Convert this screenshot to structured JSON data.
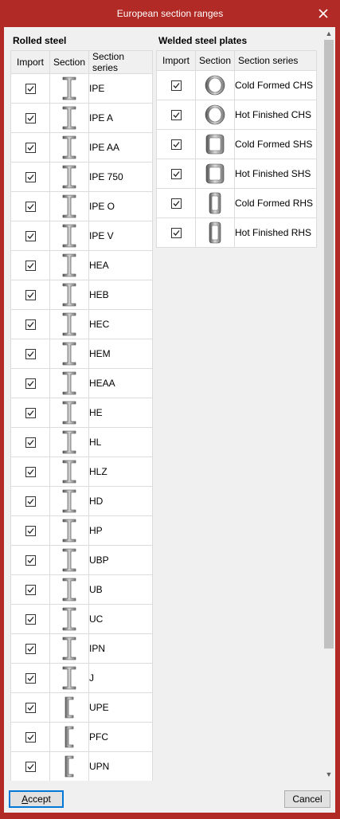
{
  "window": {
    "title": "European section ranges",
    "close_icon": "close-icon"
  },
  "columns": {
    "import": "Import",
    "section": "Section",
    "series": "Section series"
  },
  "rolled": {
    "title": "Rolled steel",
    "rows": [
      {
        "checked": true,
        "shape": "i-beam",
        "name": "IPE"
      },
      {
        "checked": true,
        "shape": "i-beam",
        "name": "IPE A"
      },
      {
        "checked": true,
        "shape": "i-beam",
        "name": "IPE AA"
      },
      {
        "checked": true,
        "shape": "i-beam",
        "name": "IPE 750"
      },
      {
        "checked": true,
        "shape": "i-beam",
        "name": "IPE O"
      },
      {
        "checked": true,
        "shape": "i-beam",
        "name": "IPE V"
      },
      {
        "checked": true,
        "shape": "i-beam",
        "name": "HEA"
      },
      {
        "checked": true,
        "shape": "i-beam",
        "name": "HEB"
      },
      {
        "checked": true,
        "shape": "i-beam",
        "name": "HEC"
      },
      {
        "checked": true,
        "shape": "i-beam",
        "name": "HEM"
      },
      {
        "checked": true,
        "shape": "i-beam",
        "name": "HEAA"
      },
      {
        "checked": true,
        "shape": "i-beam",
        "name": "HE"
      },
      {
        "checked": true,
        "shape": "i-beam",
        "name": "HL"
      },
      {
        "checked": true,
        "shape": "i-beam",
        "name": "HLZ"
      },
      {
        "checked": true,
        "shape": "i-beam",
        "name": "HD"
      },
      {
        "checked": true,
        "shape": "i-beam",
        "name": "HP"
      },
      {
        "checked": true,
        "shape": "i-beam",
        "name": "UBP"
      },
      {
        "checked": true,
        "shape": "i-beam",
        "name": "UB"
      },
      {
        "checked": true,
        "shape": "i-beam",
        "name": "UC"
      },
      {
        "checked": true,
        "shape": "i-beam",
        "name": "IPN"
      },
      {
        "checked": true,
        "shape": "i-beam",
        "name": "J"
      },
      {
        "checked": true,
        "shape": "channel",
        "name": "UPE"
      },
      {
        "checked": true,
        "shape": "channel",
        "name": "PFC"
      },
      {
        "checked": true,
        "shape": "channel",
        "name": "UPN"
      }
    ]
  },
  "welded": {
    "title": "Welded steel plates",
    "rows": [
      {
        "checked": true,
        "shape": "circular-hollow",
        "name": "Cold Formed CHS"
      },
      {
        "checked": true,
        "shape": "circular-hollow",
        "name": "Hot Finished CHS"
      },
      {
        "checked": true,
        "shape": "square-hollow",
        "name": "Cold Formed SHS"
      },
      {
        "checked": true,
        "shape": "square-hollow",
        "name": "Hot Finished SHS"
      },
      {
        "checked": true,
        "shape": "rect-hollow",
        "name": "Cold Formed RHS"
      },
      {
        "checked": true,
        "shape": "rect-hollow",
        "name": "Hot Finished RHS"
      }
    ]
  },
  "buttons": {
    "accept": "Accept",
    "cancel": "Cancel"
  },
  "colors": {
    "frame": "#b22a25",
    "client": "#f0f0f0",
    "accent": "#0078d7"
  }
}
